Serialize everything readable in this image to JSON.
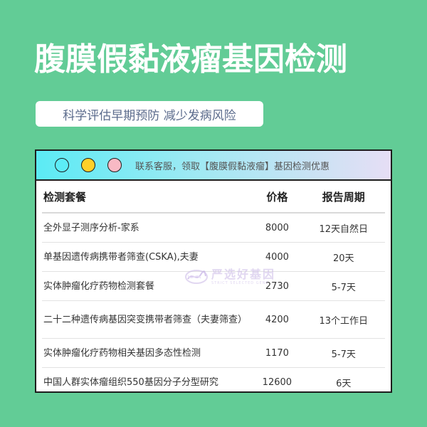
{
  "title": "腹膜假黏液瘤基因检测",
  "subtitle": "科学评估早期预防 减少发病风险",
  "card": {
    "notice": "联系客服，领取【腹膜假黏液瘤】基因检测优惠",
    "dot_colors": [
      "#5cecf6",
      "#ffd02a",
      "#f8b9c4"
    ]
  },
  "table": {
    "headers": {
      "name": "检测套餐",
      "price": "价格",
      "period": "报告周期"
    },
    "rows": [
      {
        "name": "全外显子测序分析-家系",
        "price": "8000",
        "period": "12天自然日"
      },
      {
        "name": "单基因遗传病携带者筛查(CSKA),夫妻",
        "price": "4000",
        "period": "20天"
      },
      {
        "name": "实体肿瘤化疗药物检测套餐",
        "price": "2730",
        "period": "5-7天"
      },
      {
        "name": "二十二种遗传病基因突变携带者筛查（夫妻筛查）",
        "price": "4200",
        "period": "13个工作日"
      },
      {
        "name": "实体肿瘤化疗药物相关基因多态性检测",
        "price": "1170",
        "period": "5-7天"
      },
      {
        "name": "中国人群实体瘤组织550基因分子分型研究",
        "price": "12600",
        "period": "6天"
      }
    ]
  },
  "watermark": {
    "text": "严选好基因",
    "subtext": "STRICT SELECTED GENE"
  },
  "colors": {
    "background": "#62cc96",
    "card_border": "#1d1d1d"
  }
}
